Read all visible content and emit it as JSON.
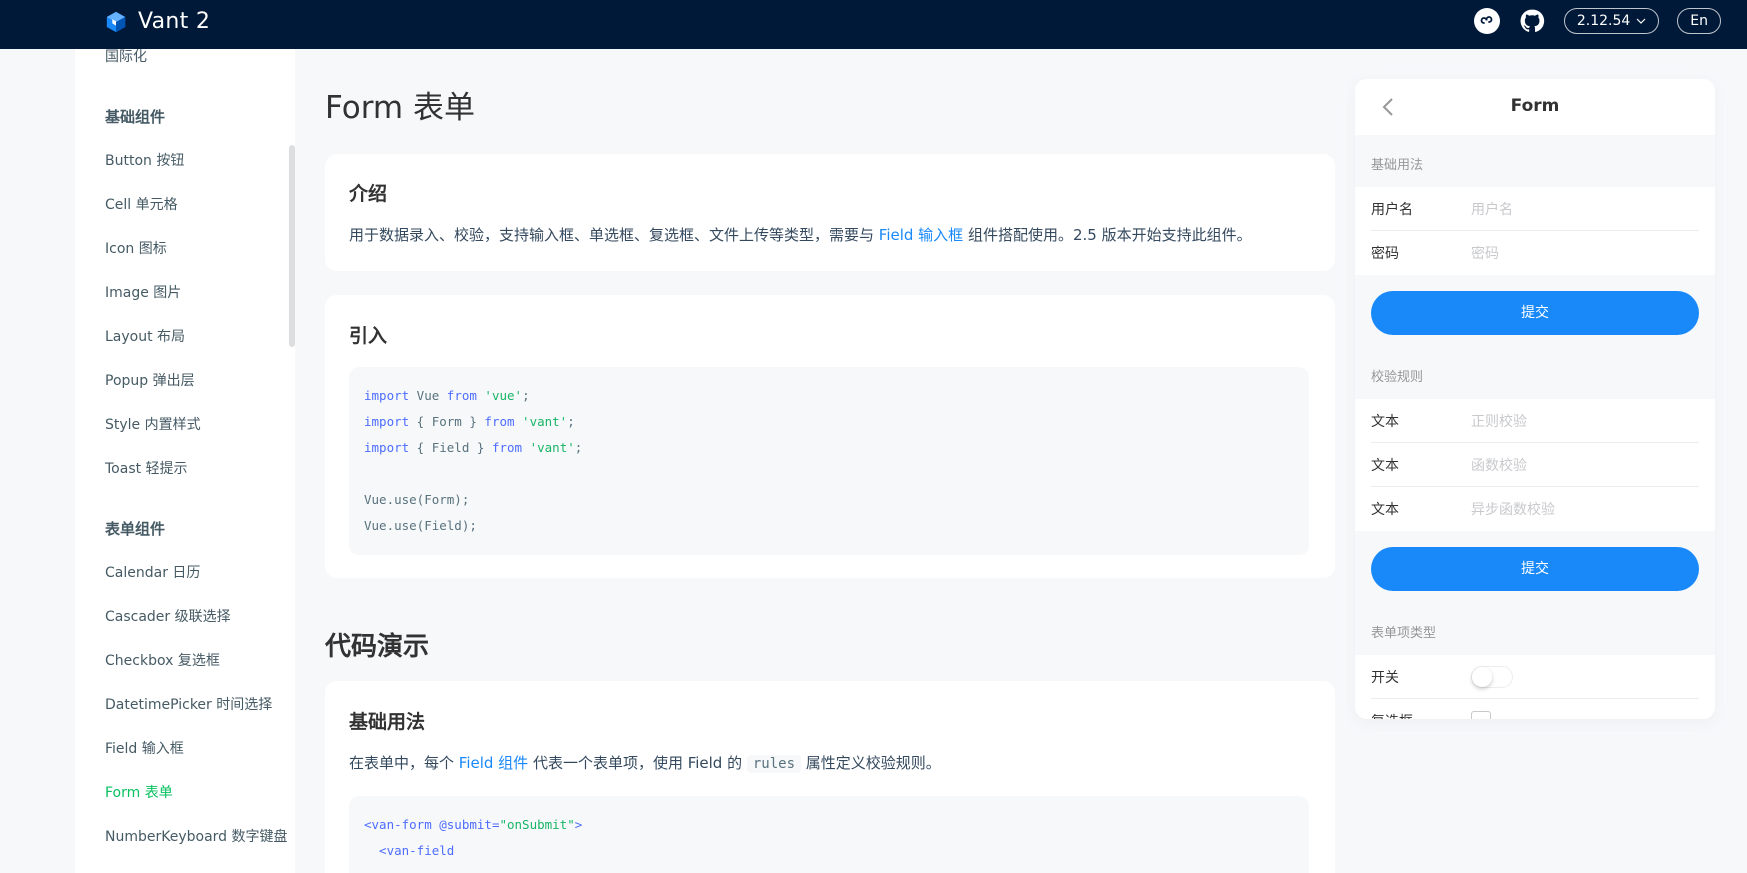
{
  "header": {
    "title": "Vant 2",
    "version": "2.12.54",
    "lang": "En",
    "icons": [
      "miniprogram-icon",
      "github-icon"
    ]
  },
  "sidebar": {
    "items": [
      {
        "label": "国际化",
        "type": "item"
      },
      {
        "label": "基础组件",
        "type": "group"
      },
      {
        "label": "Button 按钮",
        "type": "item"
      },
      {
        "label": "Cell 单元格",
        "type": "item"
      },
      {
        "label": "Icon 图标",
        "type": "item"
      },
      {
        "label": "Image 图片",
        "type": "item"
      },
      {
        "label": "Layout 布局",
        "type": "item"
      },
      {
        "label": "Popup 弹出层",
        "type": "item"
      },
      {
        "label": "Style 内置样式",
        "type": "item"
      },
      {
        "label": "Toast 轻提示",
        "type": "item"
      },
      {
        "label": "表单组件",
        "type": "group"
      },
      {
        "label": "Calendar 日历",
        "type": "item"
      },
      {
        "label": "Cascader 级联选择",
        "type": "item"
      },
      {
        "label": "Checkbox 复选框",
        "type": "item"
      },
      {
        "label": "DatetimePicker 时间选择",
        "type": "item"
      },
      {
        "label": "Field 输入框",
        "type": "item"
      },
      {
        "label": "Form 表单",
        "type": "item",
        "active": true
      },
      {
        "label": "NumberKeyboard 数字键盘",
        "type": "item"
      }
    ]
  },
  "main": {
    "title": "Form 表单",
    "intro": {
      "heading": "介绍",
      "text_before": "用于数据录入、校验，支持输入框、单选框、复选框、文件上传等类型，需要与 ",
      "link": "Field 输入框",
      "text_after": " 组件搭配使用。2.5 版本开始支持此组件。"
    },
    "import": {
      "heading": "引入",
      "code": [
        {
          "kw1": "import",
          "mid": " Vue ",
          "kw2": "from",
          "str": " 'vue'",
          "end": ";"
        },
        {
          "kw1": "import",
          "mid": " { Form } ",
          "kw2": "from",
          "str": " 'vant'",
          "end": ";"
        },
        {
          "kw1": "import",
          "mid": " { Field } ",
          "kw2": "from",
          "str": " 'vant'",
          "end": ";"
        },
        {
          "plain": "Vue.use(Form);"
        },
        {
          "plain": "Vue.use(Field);"
        }
      ]
    },
    "demo_title": "代码演示",
    "basic": {
      "heading": "基础用法",
      "text1": "在表单中，每个 ",
      "link": "Field 组件",
      "text2": " 代表一个表单项，使用 Field 的 ",
      "code": "rules",
      "text3": " 属性定义校验规则。",
      "code_lines": [
        {
          "tag": "<van-form",
          "attr": " @submit=",
          "str": "\"onSubmit\"",
          "close": ">"
        },
        {
          "tag": "  <van-field",
          "attr": "",
          "str": "",
          "close": ""
        }
      ]
    }
  },
  "simulator": {
    "title": "Form",
    "sections": [
      {
        "title": "基础用法",
        "fields": [
          {
            "label": "用户名",
            "placeholder": "用户名"
          },
          {
            "label": "密码",
            "placeholder": "密码"
          }
        ],
        "button": "提交"
      },
      {
        "title": "校验规则",
        "fields": [
          {
            "label": "文本",
            "placeholder": "正则校验"
          },
          {
            "label": "文本",
            "placeholder": "函数校验"
          },
          {
            "label": "文本",
            "placeholder": "异步函数校验"
          }
        ],
        "button": "提交"
      },
      {
        "title": "表单项类型",
        "fields": [
          {
            "label": "开关",
            "control": "switch"
          },
          {
            "label": "复选框",
            "control": "checkbox"
          }
        ]
      }
    ]
  },
  "colors": {
    "header_bg": "#001938",
    "accent": "#1989fa",
    "active_nav": "#07c160"
  }
}
